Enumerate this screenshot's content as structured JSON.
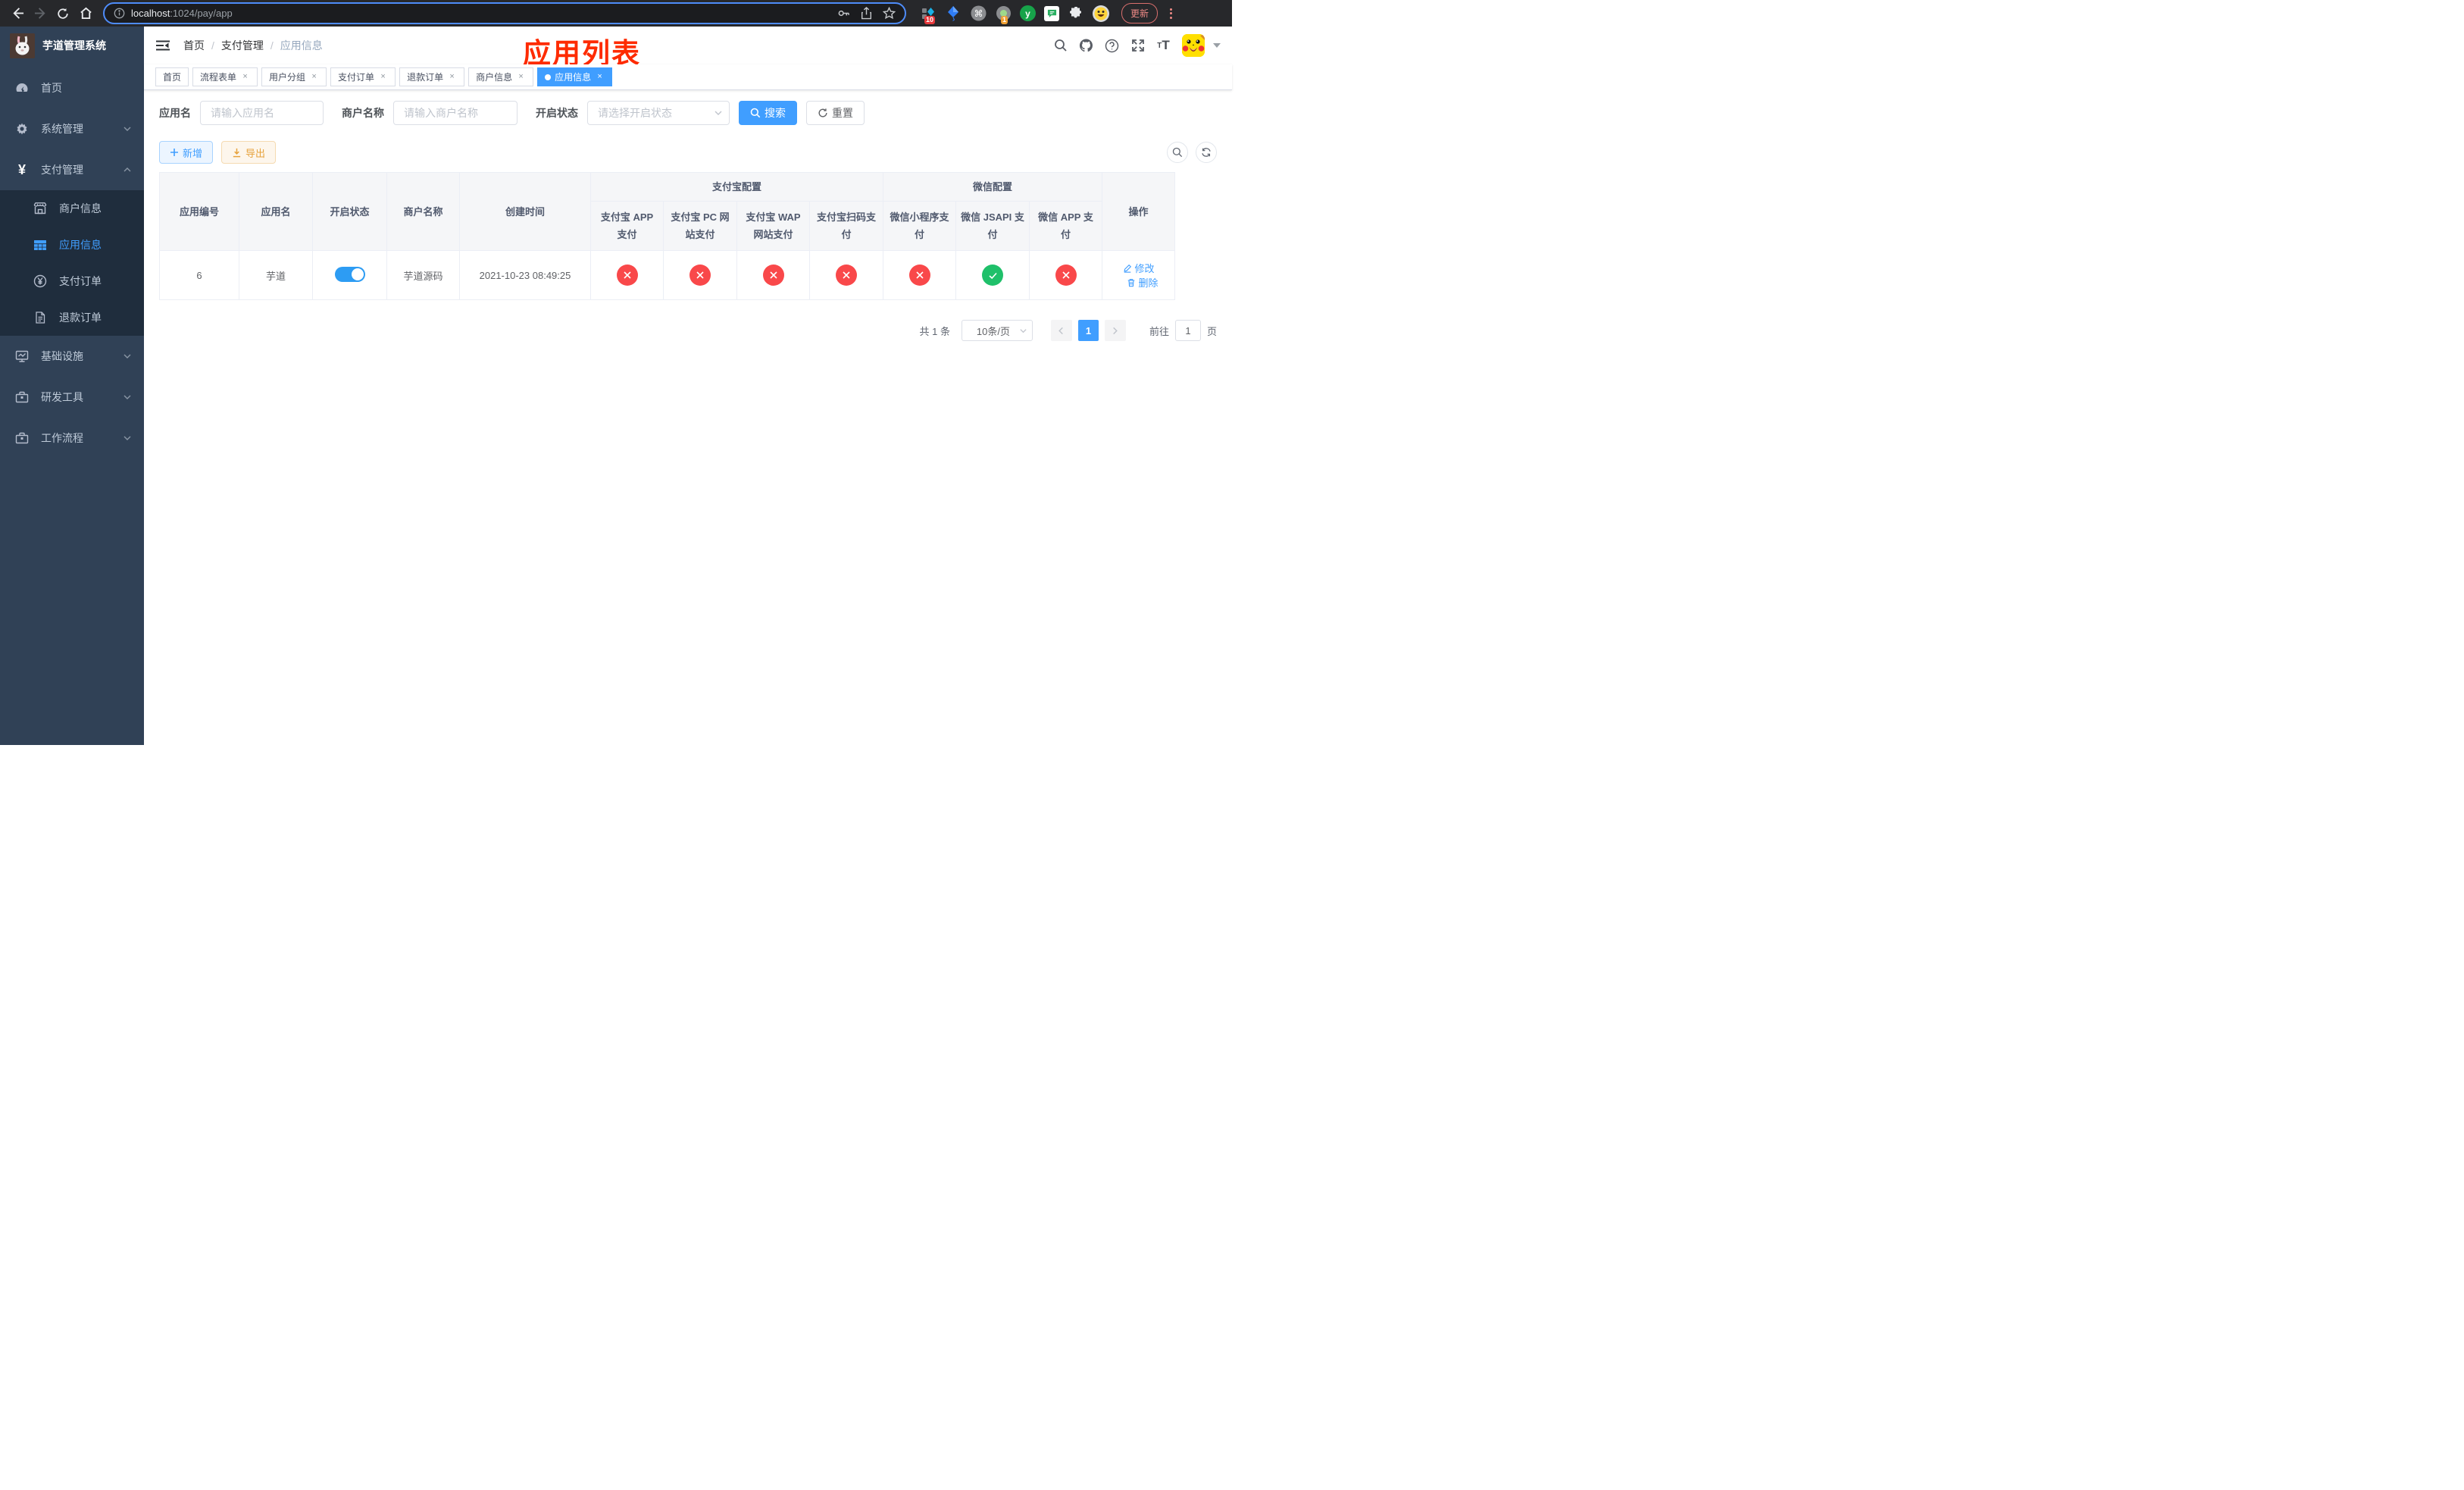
{
  "colors": {
    "accent": "#409eff",
    "danger": "#f9484a",
    "success": "#1fc06a",
    "warning": "#e6a23c",
    "sidebar_bg": "#304156",
    "submenu_bg": "#1f2d3d",
    "annotation_red": "#fe2b00"
  },
  "browser": {
    "url_host": "localhost",
    "url_path": ":1024/pay/app",
    "extension_badge_10": "10",
    "extension_badge_1": "1",
    "extension_letter": "y",
    "update_button": "更新"
  },
  "sidebar": {
    "title": "芋道管理系统",
    "items": [
      {
        "label": "首页"
      },
      {
        "label": "系统管理"
      },
      {
        "label": "支付管理"
      },
      {
        "label": "商户信息"
      },
      {
        "label": "应用信息"
      },
      {
        "label": "支付订单"
      },
      {
        "label": "退款订单"
      },
      {
        "label": "基础设施"
      },
      {
        "label": "研发工具"
      },
      {
        "label": "工作流程"
      }
    ]
  },
  "header": {
    "breadcrumb": [
      "首页",
      "支付管理",
      "应用信息"
    ],
    "annotation": "应用列表"
  },
  "tabs": [
    {
      "label": "首页"
    },
    {
      "label": "流程表单"
    },
    {
      "label": "用户分组"
    },
    {
      "label": "支付订单"
    },
    {
      "label": "退款订单"
    },
    {
      "label": "商户信息"
    },
    {
      "label": "应用信息"
    }
  ],
  "filters": {
    "app_name_label": "应用名",
    "app_name_placeholder": "请输入应用名",
    "merchant_label": "商户名称",
    "merchant_placeholder": "请输入商户名称",
    "status_label": "开启状态",
    "status_placeholder": "请选择开启状态",
    "search_label": "搜索",
    "reset_label": "重置"
  },
  "toolbar": {
    "add_label": "新增",
    "export_label": "导出"
  },
  "table": {
    "groups": {
      "alipay": "支付宝配置",
      "wechat": "微信配置"
    },
    "columns": {
      "app_id": "应用编号",
      "app_name": "应用名",
      "status": "开启状态",
      "merchant": "商户名称",
      "created": "创建时间",
      "alipay_app": "支付宝 APP 支付",
      "alipay_pc": "支付宝 PC 网站支付",
      "alipay_wap": "支付宝 WAP 网站支付",
      "alipay_qr": "支付宝扫码支付",
      "wx_mini": "微信小程序支付",
      "wx_jsapi": "微信 JSAPI 支付",
      "wx_app": "微信 APP 支付",
      "actions": "操作"
    },
    "row": {
      "app_id": "6",
      "app_name": "芋道",
      "merchant": "芋道源码",
      "created": "2021-10-23 08:49:25",
      "edit_label": "修改",
      "delete_label": "删除"
    }
  },
  "pagination": {
    "total": "共 1 条",
    "page_size": "10条/页",
    "current_page": "1",
    "goto_label": "前往",
    "goto_value": "1",
    "page_unit": "页"
  }
}
